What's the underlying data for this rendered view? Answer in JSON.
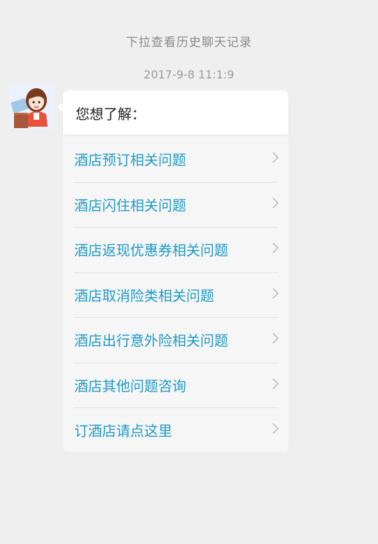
{
  "history_hint": "下拉查看历史聊天记录",
  "timestamp": "2017-9-8 11:1:9",
  "avatar": {
    "icon": "customer-service-avatar-icon"
  },
  "message": {
    "title": "您想了解：",
    "items": [
      {
        "label": "酒店预订相关问题",
        "icon": "chevron-right-icon"
      },
      {
        "label": "酒店闪住相关问题",
        "icon": "chevron-right-icon"
      },
      {
        "label": "酒店返现优惠券相关问题",
        "icon": "chevron-right-icon"
      },
      {
        "label": "酒店取消险类相关问题",
        "icon": "chevron-right-icon"
      },
      {
        "label": "酒店出行意外险相关问题",
        "icon": "chevron-right-icon"
      },
      {
        "label": "酒店其他问题咨询",
        "icon": "chevron-right-icon"
      },
      {
        "label": "订酒店请点这里",
        "icon": "chevron-right-icon"
      }
    ]
  },
  "colors": {
    "background": "#efeff0",
    "link": "#1f9ac8",
    "hint": "#8a8a8a"
  }
}
